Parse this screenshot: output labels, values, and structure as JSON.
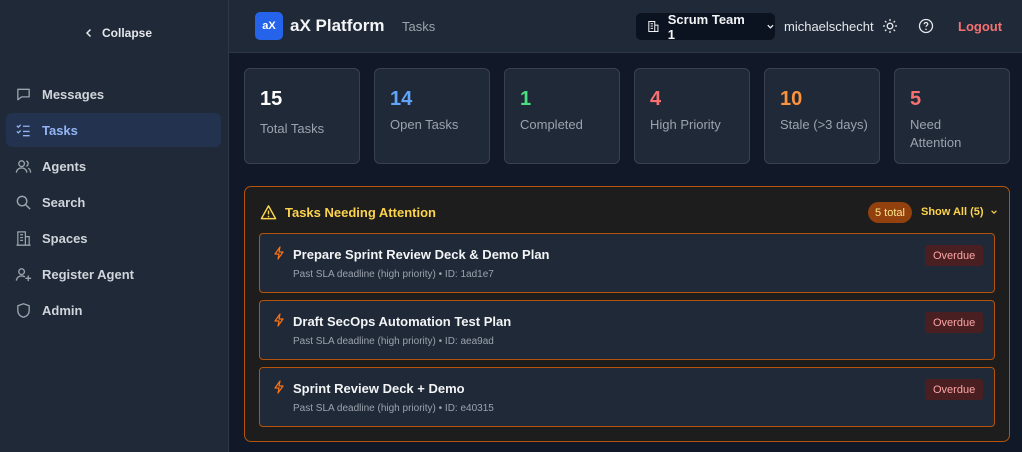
{
  "sidebar": {
    "collapse_label": "Collapse",
    "items": [
      {
        "label": "Messages",
        "icon": "message-icon",
        "active": false
      },
      {
        "label": "Tasks",
        "icon": "task-list-icon",
        "active": true
      },
      {
        "label": "Agents",
        "icon": "users-icon",
        "active": false
      },
      {
        "label": "Search",
        "icon": "search-icon",
        "active": false
      },
      {
        "label": "Spaces",
        "icon": "building-icon",
        "active": false
      },
      {
        "label": "Register Agent",
        "icon": "user-plus-icon",
        "active": false
      },
      {
        "label": "Admin",
        "icon": "shield-icon",
        "active": false
      }
    ]
  },
  "header": {
    "logo_text": "aX",
    "brand": "aX Platform",
    "breadcrumb": "Tasks",
    "team": "Scrum Team 1",
    "username": "michaelschecht",
    "logout": "Logout"
  },
  "stats": [
    {
      "value": "15",
      "label": "Total Tasks",
      "color": "#ffffff"
    },
    {
      "value": "14",
      "label": "Open Tasks",
      "color": "#60a5fa"
    },
    {
      "value": "1",
      "label": "Completed",
      "color": "#4ade80"
    },
    {
      "value": "4",
      "label": "High Priority",
      "color": "#f87171"
    },
    {
      "value": "10",
      "label": "Stale (>3 days)",
      "color": "#fb923c"
    },
    {
      "value": "5",
      "label": "Need Attention",
      "color": "#f87171"
    }
  ],
  "attention": {
    "title": "Tasks Needing Attention",
    "total_badge": "5 total",
    "show_all": "Show All (5)",
    "tasks": [
      {
        "title": "Prepare Sprint Review Deck & Demo Plan",
        "subtitle": "Past SLA deadline (high priority) • ID: 1ad1e7",
        "status": "Overdue"
      },
      {
        "title": "Draft SecOps Automation Test Plan",
        "subtitle": "Past SLA deadline (high priority) • ID: aea9ad",
        "status": "Overdue"
      },
      {
        "title": "Sprint Review Deck + Demo",
        "subtitle": "Past SLA deadline (high priority) • ID: e40315",
        "status": "Overdue"
      }
    ]
  },
  "colors": {
    "accent": "#2563eb",
    "warning": "#b45309",
    "danger": "#f87171"
  }
}
